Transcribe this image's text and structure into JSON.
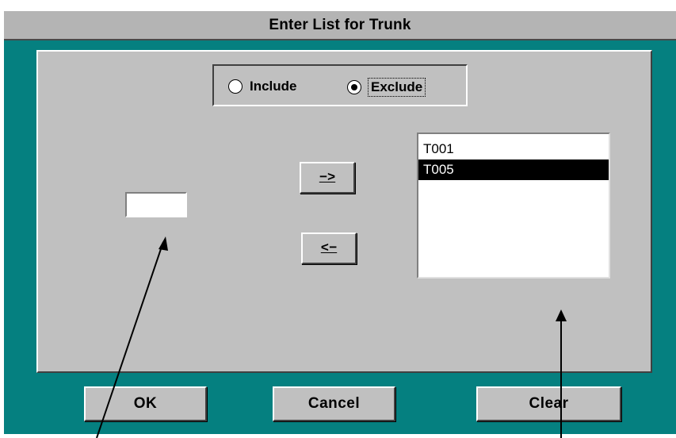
{
  "dialog": {
    "title": "Enter List for Trunk",
    "mode_group": {
      "options": [
        {
          "label": "Include",
          "selected": false
        },
        {
          "label": "Exclude",
          "selected": true
        }
      ]
    },
    "entry_value": "",
    "add_button_label": "−>",
    "remove_button_label": "<−",
    "list_items": [
      {
        "label": "T001",
        "selected": false
      },
      {
        "label": "T005",
        "selected": true
      }
    ],
    "buttons": {
      "ok": "OK",
      "cancel": "Cancel",
      "clear": "Clear"
    }
  },
  "colors": {
    "frame": "#058080",
    "face": "#c0c0c0",
    "selection": "#000000"
  }
}
